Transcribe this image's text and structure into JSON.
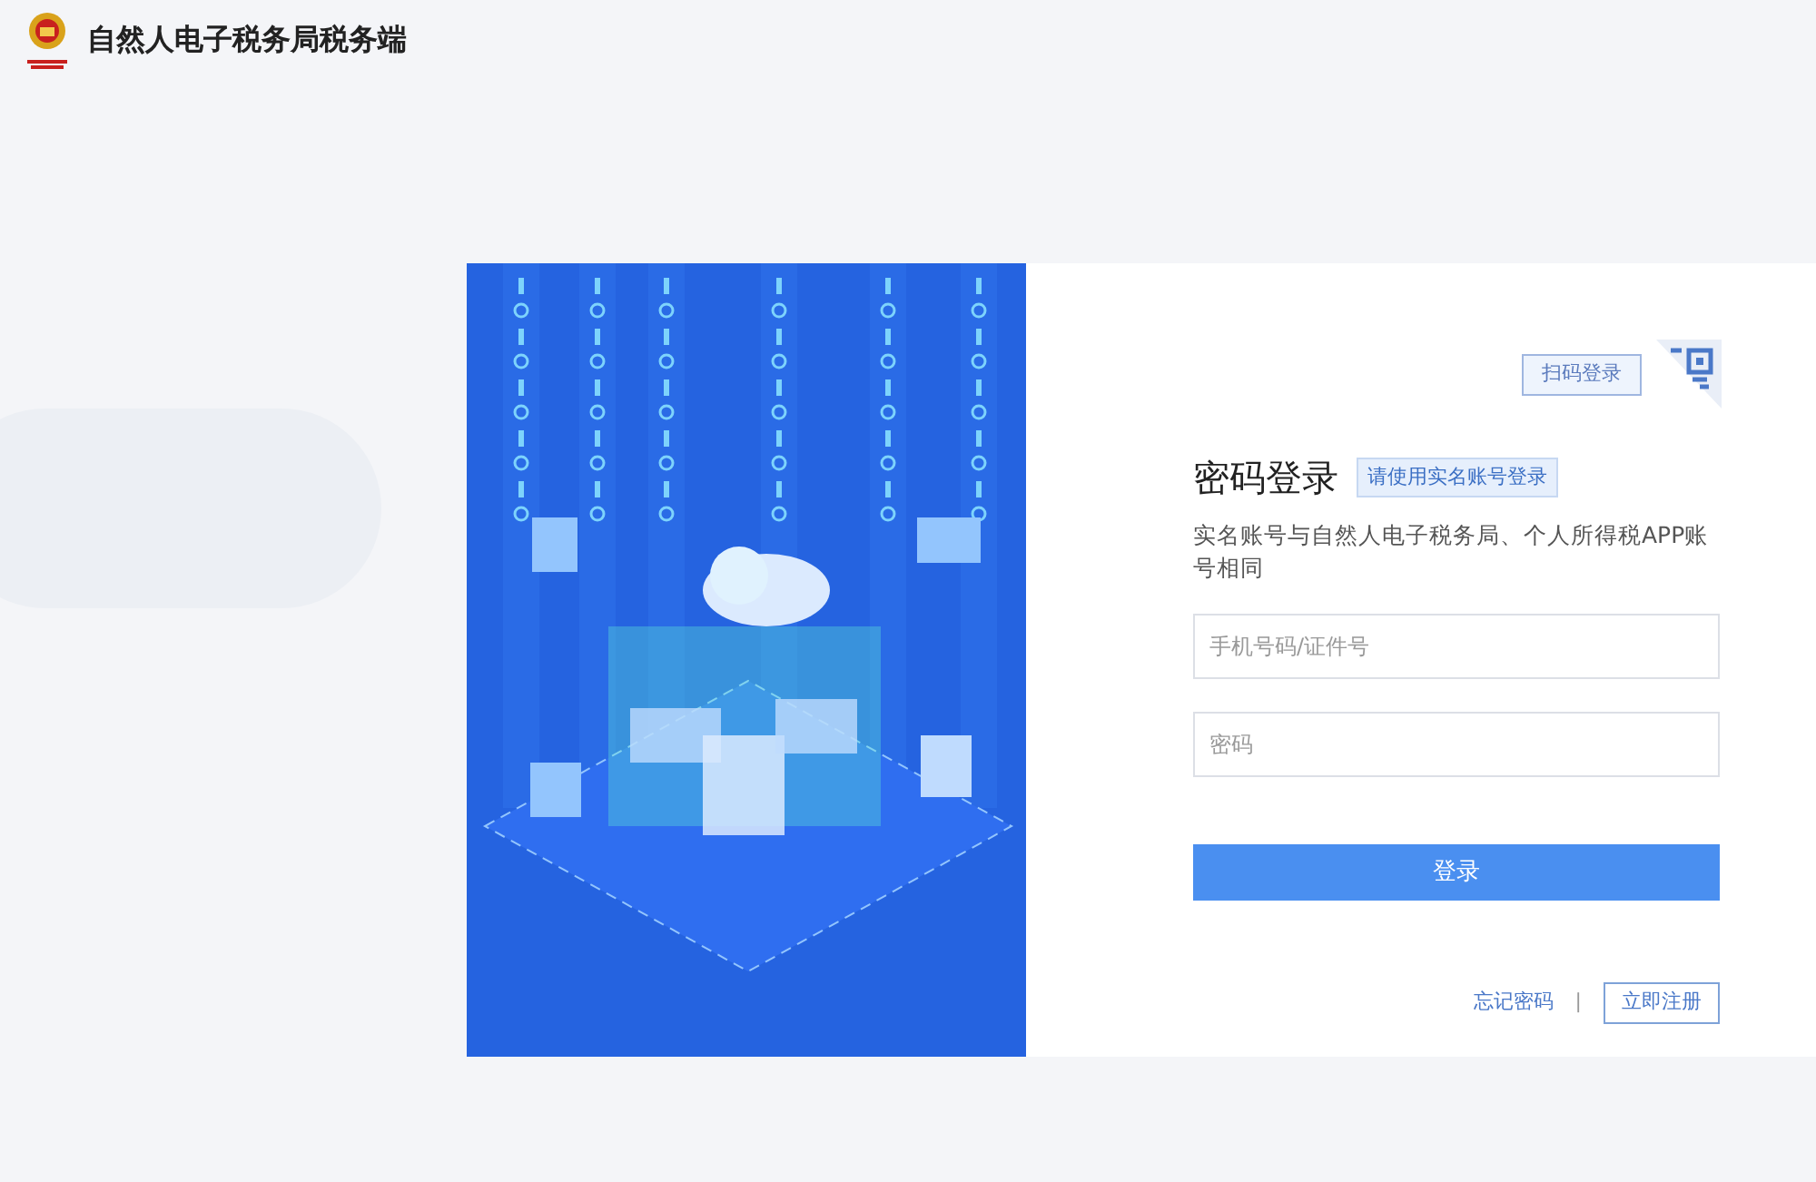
{
  "header": {
    "title": "自然人电子税务局税务端"
  },
  "login": {
    "qr_tip": "扫码登录",
    "title": "密码登录",
    "badge": "请使用实名账号登录",
    "description": "实名账号与自然人电子税务局、个人所得税APP账号相同",
    "fields": [
      {
        "placeholder": "手机号码/证件号"
      },
      {
        "placeholder": "密码"
      }
    ],
    "submit": "登录",
    "forgot": "忘记密码",
    "separator": "|",
    "register": "立即注册"
  }
}
